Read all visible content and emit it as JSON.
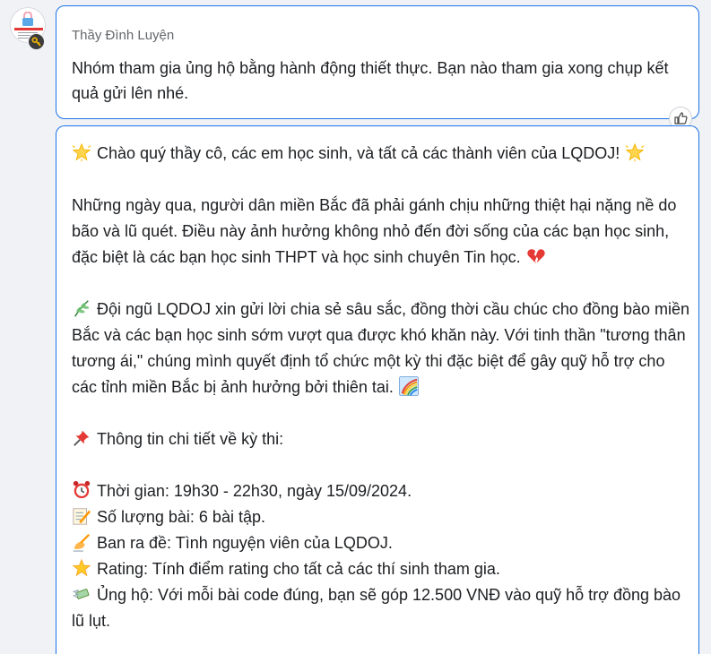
{
  "message1": {
    "sender": "Thầy Đình Luyện",
    "text": "Nhóm tham gia ủng hộ bằng hành động thiết thực. Bạn nào tham gia xong chụp kết quả gửi lên nhé."
  },
  "message2": {
    "greeting": "Chào quý thầy cô, các em học sinh, và tất cả các thành viên của LQDOJ!",
    "para1": "Những ngày qua, người dân miền Bắc đã phải gánh chịu những thiệt hại nặng nề do bão và lũ quét. Điều này ảnh hưởng không nhỏ đến đời sống của các bạn học sinh, đặc biệt là các bạn học sinh THPT và học sinh chuyên Tin học.",
    "para2": "Đội ngũ LQDOJ xin gửi lời chia sẻ sâu sắc, đồng thời cầu chúc cho đồng bào miền Bắc và các bạn học sinh sớm vượt qua được khó khăn này. Với tinh thần \"tương thân tương ái,\" chúng mình quyết định tổ chức một kỳ thi đặc biệt để gây quỹ hỗ trợ cho các tỉnh miền Bắc bị ảnh hưởng bởi thiên tai.",
    "details_heading": "Thông tin chi tiết về kỳ thi:",
    "details": [
      {
        "icon": "alarm-clock-icon",
        "text": "Thời gian: 19h30 - 22h30, ngày 15/09/2024."
      },
      {
        "icon": "memo-icon",
        "text": "Số lượng bài: 6 bài tập."
      },
      {
        "icon": "writing-hand-icon",
        "text": "Ban ra đề: Tình nguyện viên của LQDOJ."
      },
      {
        "icon": "star-icon",
        "text": "Rating: Tính điểm rating cho tất cả các thí sinh tham gia."
      },
      {
        "icon": "money-wings-icon",
        "text": "Ủng hộ: Với mỗi bài code đúng, bạn sẽ góp 12.500 VNĐ vào quỹ hỗ trợ đồng bào lũ lụt."
      }
    ]
  },
  "colors": {
    "bubble_border": "#1a73e8",
    "page_bg": "#f0f2f5",
    "meta_text": "#65676b"
  }
}
